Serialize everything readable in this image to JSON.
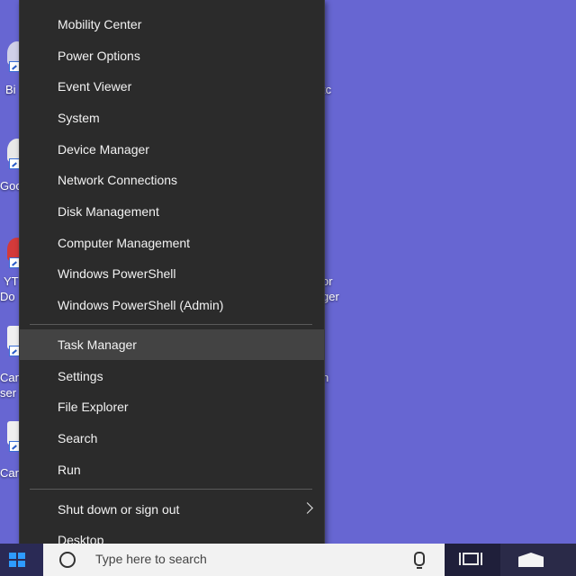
{
  "context_menu": {
    "items_group1": [
      "Mobility Center",
      "Power Options",
      "Event Viewer",
      "System",
      "Device Manager",
      "Network Connections",
      "Disk Management",
      "Computer Management",
      "Windows PowerShell",
      "Windows PowerShell (Admin)"
    ],
    "items_group2": [
      "Task Manager",
      "Settings",
      "File Explorer",
      "Search",
      "Run"
    ],
    "items_group3": [
      "Shut down or sign out",
      "Desktop"
    ],
    "hovered_item": "Task Manager",
    "submenu_item": "Shut down or sign out"
  },
  "desktop": {
    "background_color": "#6766d2",
    "icons": [
      {
        "label": "Bi",
        "icon": "app-icon"
      },
      {
        "label": "Goo",
        "icon": "app-icon"
      },
      {
        "label": "YT",
        "icon": "app-icon"
      },
      {
        "label": "Do",
        "icon": "app-icon"
      },
      {
        "label": "Cam",
        "icon": "app-icon"
      },
      {
        "label": "ser",
        "icon": "app-icon"
      },
      {
        "label": "Can",
        "icon": "app-icon"
      }
    ],
    "right_fragments": [
      "tc",
      "or",
      "ger",
      "n"
    ]
  },
  "taskbar": {
    "search_placeholder": "Type here to search",
    "icons": [
      "windows-logo-icon",
      "search-icon",
      "microphone-icon",
      "task-view-icon",
      "mail-icon"
    ]
  },
  "colors": {
    "menu_bg": "#2b2b2b",
    "menu_hover": "#434343",
    "menu_text": "#f2f2f2",
    "taskbar": "#1f1f3a",
    "accent": "#2e9bff"
  }
}
